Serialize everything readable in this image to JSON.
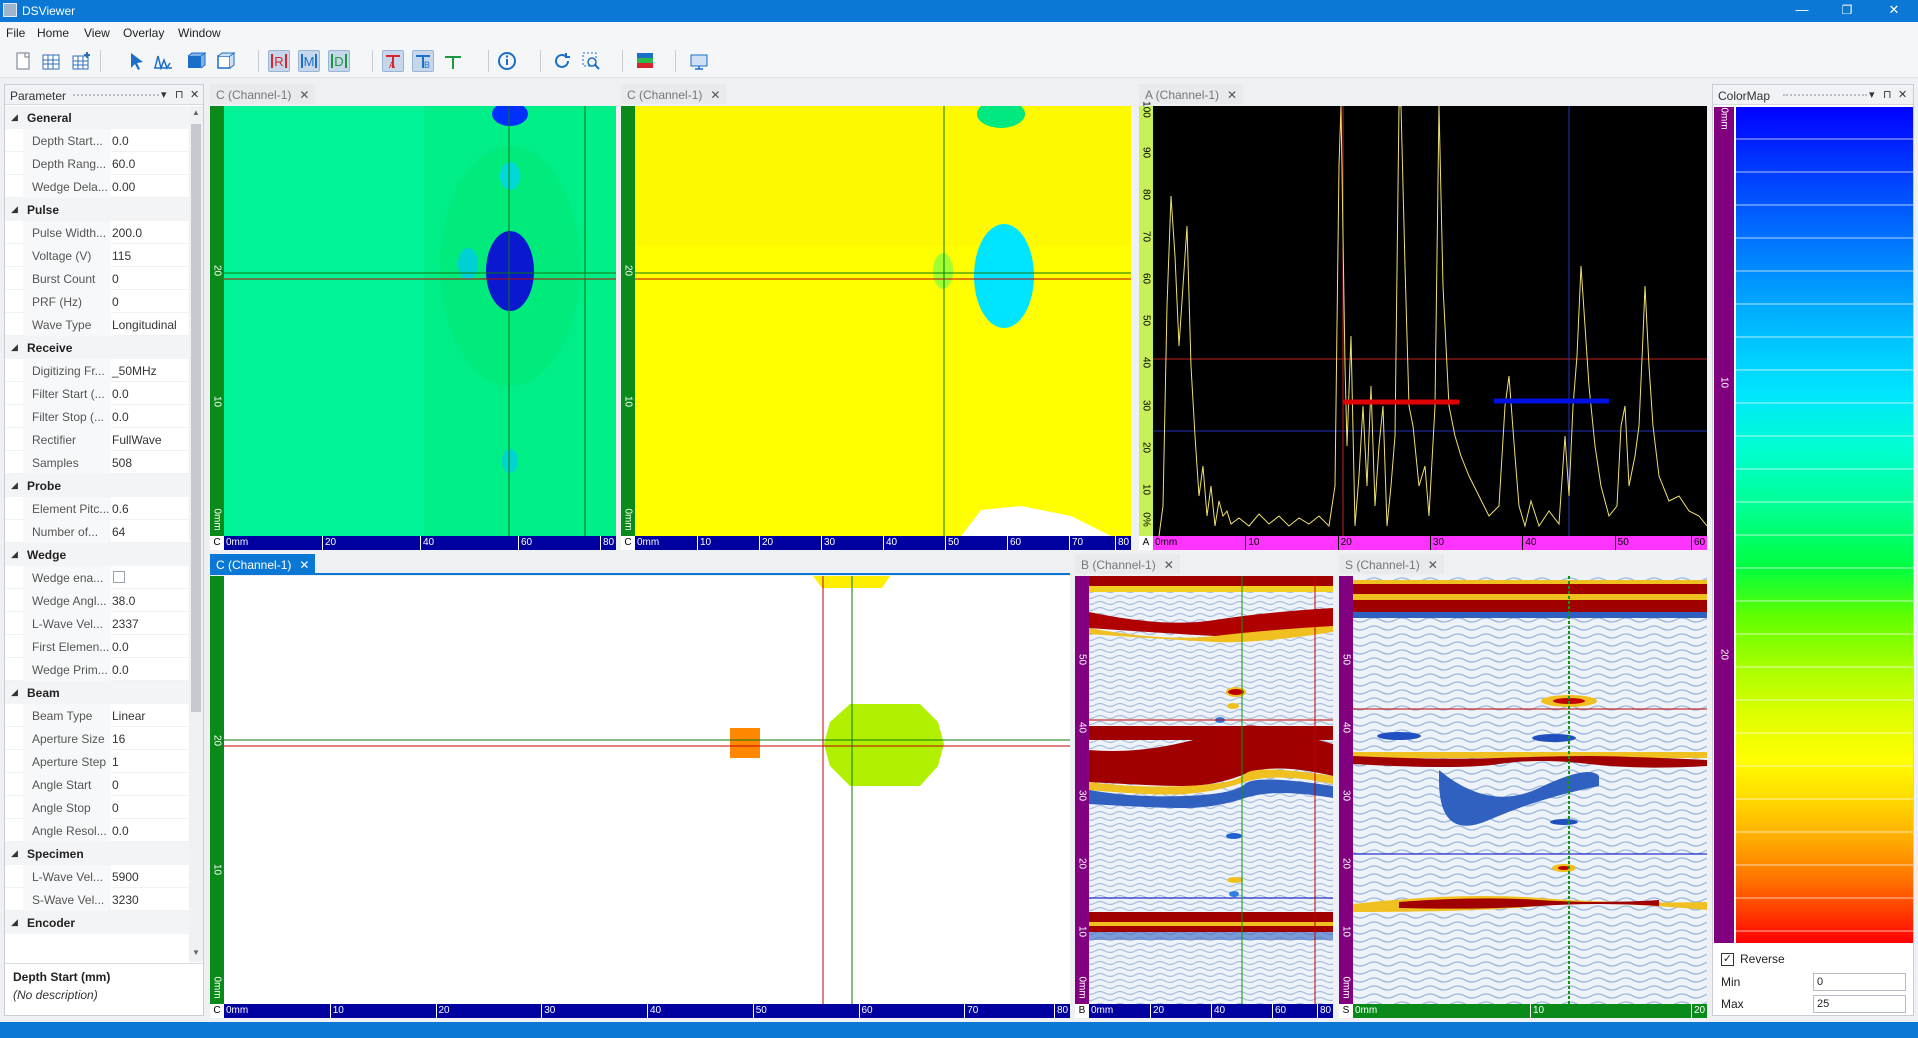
{
  "window": {
    "title": "DSViewer",
    "minimize": "—",
    "maximize": "❐",
    "close": "✕"
  },
  "menu": [
    "File",
    "Home",
    "View",
    "Overlay",
    "Window"
  ],
  "toolbar": {
    "icons": [
      "new-file-icon",
      "open-grid-icon",
      "add-grid-icon",
      "pointer-icon",
      "waveform-icon",
      "box-icon",
      "3d-box-icon",
      "ref-cursor-icon",
      "measure-cursor-icon",
      "data-cursor-icon",
      "a-gate-icon",
      "b-gate-icon",
      "gate-icon",
      "info-icon",
      "refresh-icon",
      "zoom-region-icon",
      "palette-icon",
      "export-icon"
    ],
    "labels": {
      "ref": "R",
      "measure": "M",
      "data": "D"
    }
  },
  "parameter_panel": {
    "title": "Parameter",
    "groups": [
      {
        "name": "General",
        "rows": [
          {
            "k": "Depth Start...",
            "v": "0.0"
          },
          {
            "k": "Depth Rang...",
            "v": "60.0"
          },
          {
            "k": "Wedge Dela...",
            "v": "0.00"
          }
        ]
      },
      {
        "name": "Pulse",
        "rows": [
          {
            "k": "Pulse Width...",
            "v": "200.0"
          },
          {
            "k": "Voltage (V)",
            "v": "115"
          },
          {
            "k": "Burst Count",
            "v": "0"
          },
          {
            "k": "PRF (Hz)",
            "v": "0"
          },
          {
            "k": "Wave Type",
            "v": "Longitudinal"
          }
        ]
      },
      {
        "name": "Receive",
        "rows": [
          {
            "k": "Digitizing Fr...",
            "v": "_50MHz"
          },
          {
            "k": "Filter Start (...",
            "v": "0.0"
          },
          {
            "k": "Filter Stop (...",
            "v": "0.0"
          },
          {
            "k": "Rectifier",
            "v": "FullWave"
          },
          {
            "k": "Samples",
            "v": "508"
          }
        ]
      },
      {
        "name": "Probe",
        "rows": [
          {
            "k": "Element Pitc...",
            "v": "0.6"
          },
          {
            "k": "Number of...",
            "v": "64"
          }
        ]
      },
      {
        "name": "Wedge",
        "rows": [
          {
            "k": "Wedge ena...",
            "v": "",
            "checkbox": true
          },
          {
            "k": "Wedge Angl...",
            "v": "38.0"
          },
          {
            "k": "L-Wave Vel...",
            "v": "2337"
          },
          {
            "k": "First Elemen...",
            "v": "0.0"
          },
          {
            "k": "Wedge Prim...",
            "v": "0.0"
          }
        ]
      },
      {
        "name": "Beam",
        "rows": [
          {
            "k": "Beam Type",
            "v": "Linear"
          },
          {
            "k": "Aperture Size",
            "v": "16"
          },
          {
            "k": "Aperture Step",
            "v": "1"
          },
          {
            "k": "Angle Start",
            "v": "0"
          },
          {
            "k": "Angle Stop",
            "v": "0"
          },
          {
            "k": "Angle Resol...",
            "v": "0.0"
          }
        ]
      },
      {
        "name": "Specimen",
        "rows": [
          {
            "k": "L-Wave Vel...",
            "v": "5900"
          },
          {
            "k": "S-Wave Vel...",
            "v": "3230"
          }
        ]
      },
      {
        "name": "Encoder",
        "rows": []
      }
    ],
    "description": {
      "title": "Depth Start (mm)",
      "text": "(No description)"
    }
  },
  "views": {
    "c1": {
      "tab": "C (Channel-1)",
      "corner": "C",
      "xunit": "0mm",
      "xticks": [
        "20",
        "40",
        "60",
        "80"
      ],
      "yunit": "0mm",
      "yticks": [
        "10",
        "20"
      ]
    },
    "c2": {
      "tab": "C (Channel-1)",
      "corner": "C",
      "xunit": "0mm",
      "xticks": [
        "10",
        "20",
        "30",
        "40",
        "50",
        "60",
        "70",
        "80"
      ],
      "yunit": "0mm",
      "yticks": [
        "10",
        "20"
      ]
    },
    "a": {
      "tab": "A (Channel-1)",
      "corner": "A",
      "xunit": "0mm",
      "xticks": [
        "10",
        "20",
        "30",
        "40",
        "50",
        "60"
      ],
      "yunit": "0%",
      "yticks": [
        "10",
        "20",
        "30",
        "40",
        "50",
        "60",
        "70",
        "80",
        "90",
        "100"
      ]
    },
    "c3": {
      "tab": "C (Channel-1)",
      "corner": "C",
      "xunit": "0mm",
      "xticks": [
        "10",
        "20",
        "30",
        "40",
        "50",
        "60",
        "70",
        "80"
      ],
      "yunit": "0mm",
      "yticks": [
        "10",
        "20"
      ]
    },
    "b": {
      "tab": "B (Channel-1)",
      "corner": "B",
      "xunit": "0mm",
      "xticks": [
        "20",
        "40",
        "60",
        "80"
      ],
      "yunit": "0mm",
      "yticks": [
        "10",
        "20",
        "30",
        "40",
        "50"
      ]
    },
    "s": {
      "tab": "S (Channel-1)",
      "corner": "S",
      "xunit": "0mm",
      "xticks": [
        "10",
        "20"
      ],
      "yunit": "0mm",
      "yticks": [
        "10",
        "20",
        "30",
        "40",
        "50"
      ]
    }
  },
  "colormap": {
    "title": "ColorMap",
    "axis_unit": "0mm",
    "axis_ticks": [
      "10",
      "20"
    ],
    "reverse_label": "Reverse",
    "reverse_checked": "✓",
    "min_label": "Min",
    "min_value": "0",
    "max_label": "Max",
    "max_value": "25",
    "colors": {
      "low": "#0000ff",
      "mid": "#00ff40",
      "high": "#ff0000"
    }
  },
  "panel_icons": {
    "dropdown": "▾",
    "pin": "⊓",
    "close": "✕"
  }
}
